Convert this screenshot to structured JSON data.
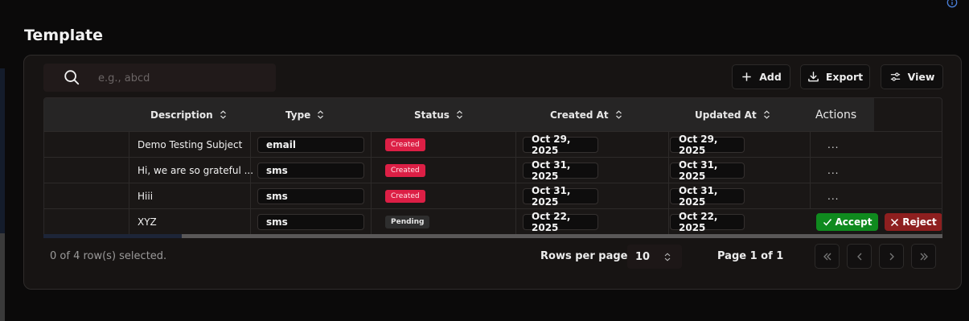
{
  "page": {
    "title": "Template"
  },
  "search": {
    "placeholder": "e.g., abcd",
    "value": ""
  },
  "toolbar": {
    "add_label": "Add",
    "export_label": "Export",
    "view_label": "View"
  },
  "table": {
    "columns": [
      "Description",
      "Type",
      "Status",
      "Created At",
      "Updated At"
    ],
    "actions_label": "Actions",
    "rows": [
      {
        "description": "Demo Testing Subject",
        "type": "email",
        "status": "Created",
        "created_at": "Oct 29, 2025",
        "updated_at": "Oct 29, 2025",
        "action": "..."
      },
      {
        "description": "Hi, we are so grateful ...",
        "type": "sms",
        "status": "Created",
        "created_at": "Oct 31, 2025",
        "updated_at": "Oct 31, 2025",
        "action": "..."
      },
      {
        "description": "Hiii",
        "type": "sms",
        "status": "Created",
        "created_at": "Oct 31, 2025",
        "updated_at": "Oct 31, 2025",
        "action": "..."
      },
      {
        "description": "XYZ",
        "type": "sms",
        "status": "Pending",
        "created_at": "Oct 22, 2025",
        "updated_at": "Oct 22, 2025",
        "accept_label": "Accept",
        "reject_label": "Reject"
      }
    ]
  },
  "footer": {
    "selection_text": "0 of 4 row(s) selected.",
    "rows_per_page_label": "Rows per page",
    "rows_per_page_value": "10",
    "page_info": "Page 1 of 1"
  },
  "colors": {
    "background": "#0b0a0a",
    "card": "#171413",
    "created_badge": "#dc1f45",
    "accept": "#0f8a1e",
    "reject": "#8e1f1f"
  },
  "icons": {
    "info": "info-icon",
    "search": "search-icon",
    "add": "plus-icon",
    "export": "download-icon",
    "view": "sliders-icon",
    "sort": "sort-icon",
    "first": "chevrons-left-icon",
    "prev": "chevron-left-icon",
    "next": "chevron-right-icon",
    "last": "chevrons-right-icon"
  }
}
